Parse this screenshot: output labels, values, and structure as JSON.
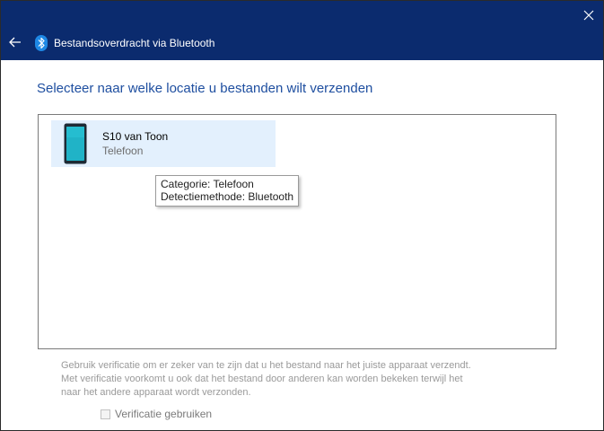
{
  "window": {
    "title": "Bestandsoverdracht via Bluetooth",
    "icons": {
      "close": "close-icon",
      "back": "back-arrow-icon",
      "app": "bluetooth-icon"
    },
    "colors": {
      "titlebar": "#0b2b6e",
      "heading": "#1f4fa0",
      "selection": "#e3f0fd"
    }
  },
  "main": {
    "heading": "Selecteer naar welke locatie u bestanden wilt verzenden",
    "devices": [
      {
        "name": "S10 van Toon",
        "type": "Telefoon",
        "icon": "phone-icon",
        "selected": true
      }
    ],
    "tooltip": {
      "category": "Categorie: Telefoon",
      "detection": "Detectiemethode: Bluetooth"
    },
    "verification": {
      "lines": [
        "Gebruik verificatie om er zeker van te zijn dat u het bestand naar het juiste apparaat verzendt.",
        "Met verificatie voorkomt u ook dat het bestand door anderen kan worden bekeken terwijl het",
        "naar het andere apparaat wordt verzonden."
      ],
      "checkbox_label": "Verificatie gebruiken",
      "checked": false,
      "enabled": false
    }
  }
}
